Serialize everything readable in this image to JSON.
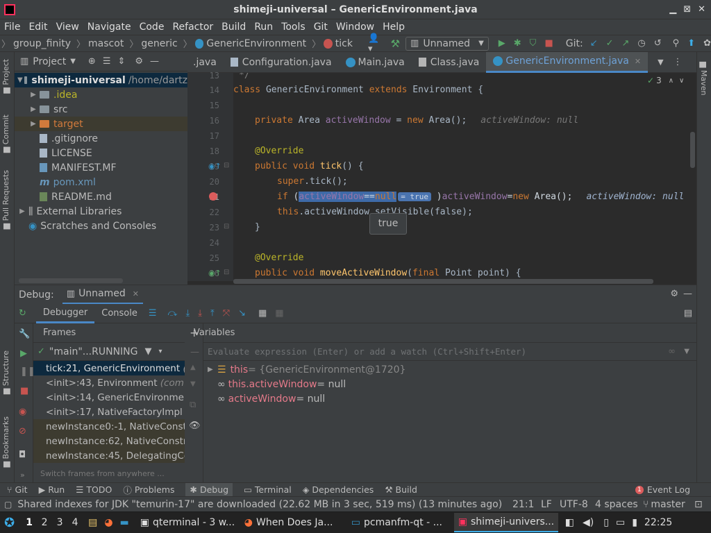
{
  "window": {
    "title": "shimeji-universal – GenericEnvironment.java"
  },
  "menu": [
    "File",
    "Edit",
    "View",
    "Navigate",
    "Code",
    "Refactor",
    "Build",
    "Run",
    "Tools",
    "Git",
    "Window",
    "Help"
  ],
  "breadcrumb": [
    "group_finity",
    "mascot",
    "generic",
    "GenericEnvironment",
    "tick"
  ],
  "toolbar": {
    "run_config": "Unnamed",
    "git_label": "Git:"
  },
  "project": {
    "header": "Project",
    "root_name": "shimeji-universal",
    "root_path": "/home/dartz",
    "items": [
      ".idea",
      "src",
      "target",
      ".gitignore",
      "LICENSE",
      "MANIFEST.MF",
      "pom.xml",
      "README.md"
    ],
    "external": "External Libraries",
    "scratches": "Scratches and Consoles"
  },
  "tabs": [
    {
      "label": ".java",
      "active": false
    },
    {
      "label": "Configuration.java",
      "active": false
    },
    {
      "label": "Main.java",
      "active": false
    },
    {
      "label": "Class.java",
      "active": false
    },
    {
      "label": "GenericEnvironment.java",
      "active": true
    }
  ],
  "editor": {
    "line_numbers": [
      "13",
      "14",
      "15",
      "16",
      "17",
      "18",
      "19",
      "20",
      "21",
      "22",
      "23",
      "24",
      "25",
      "26"
    ],
    "warn_count": "3",
    "lines": {
      "l13": "*/",
      "l14_kw": "class",
      "l14_name": " GenericEnvironment ",
      "l14_kw2": "extends",
      "l14_rest": " Environment {",
      "l16_kw": "private",
      "l16_type": " Area ",
      "l16_field": "activeWindow",
      "l16_eq": " = ",
      "l16_new": "new",
      "l16_rest": " Area();",
      "l16_hint": "activeWindow: null",
      "l18": "@Override",
      "l19_kw": "public void",
      "l19_fn": " tick",
      "l19_rest": "() {",
      "l20_kw": "super",
      "l20_rest": ".tick();",
      "l21_kw": "if",
      "l21_a": " (",
      "l21_field": "activeWindow",
      "l21_eq": "==",
      "l21_null": "null",
      "l21_badge": "= true",
      "l21_b": " )",
      "l21_field2": "activeWindow",
      "l21_c": "=",
      "l21_new": "new",
      "l21_d": " Area();",
      "l21_hint": "activeWindow: null",
      "l22_kw": "this",
      "l22_rest": ".activeWindow.setVisible(false);",
      "l23": "}",
      "l25": "@Override",
      "l26_kw": "public void",
      "l26_fn": " moveActiveWindow",
      "l26_a": "(",
      "l26_kw2": "final",
      "l26_rest": " Point point) {"
    },
    "tooltip": "true"
  },
  "debug": {
    "label": "Debug:",
    "session": "Unnamed",
    "tabs": [
      "Debugger",
      "Console"
    ],
    "frames_header": "Frames",
    "thread": "\"main\"...RUNNING",
    "frames": [
      {
        "text": "tick:21, GenericEnvironment",
        "tail": "(c",
        "kind": "sel"
      },
      {
        "text": "<init>:43, Environment",
        "tail": "(com",
        "kind": "normal"
      },
      {
        "text": "<init>:14, GenericEnvironmen",
        "tail": "",
        "kind": "normal"
      },
      {
        "text": "<init>:17, NativeFactoryImpl",
        "tail": "(",
        "kind": "normal"
      },
      {
        "text": "newInstance0:-1, NativeConstr",
        "tail": "",
        "kind": "lib"
      },
      {
        "text": "newInstance:62, NativeConstru",
        "tail": "",
        "kind": "lib"
      },
      {
        "text": "newInstance:45, DelegatingCo",
        "tail": "",
        "kind": "lib"
      }
    ],
    "frames_hint": "Switch frames from anywhere ...",
    "variables_header": "Variables",
    "eval_placeholder": "Evaluate expression (Enter) or add a watch (Ctrl+Shift+Enter)",
    "variables": [
      {
        "name": "this",
        "value": " = {GenericEnvironment@1720}"
      },
      {
        "name": "this.activeWindow",
        "value": " = null"
      },
      {
        "name": "activeWindow",
        "value": " = null"
      }
    ]
  },
  "bottom_tabs": [
    "Git",
    "Run",
    "TODO",
    "Problems",
    "Debug",
    "Terminal",
    "Dependencies",
    "Build"
  ],
  "event_log": "Event Log",
  "status": {
    "message": "Shared indexes for JDK \"temurin-17\" are downloaded (22.62 MB in 3 sec, 519 ms) (13 minutes ago)",
    "position": "21:1",
    "line_sep": "LF",
    "encoding": "UTF-8",
    "indent": "4 spaces",
    "branch": "master"
  },
  "taskbar": {
    "workspaces": [
      "1",
      "2",
      "3",
      "4"
    ],
    "tasks": [
      "qterminal - 3 w...",
      "When Does Ja...",
      "pcmanfm-qt - ...",
      "shimeji-univers..."
    ],
    "clock": "22:25"
  },
  "colors": {
    "accent": "#4a88c7",
    "selection": "#2d5ca0",
    "breakpoint": "#db5c5c"
  }
}
